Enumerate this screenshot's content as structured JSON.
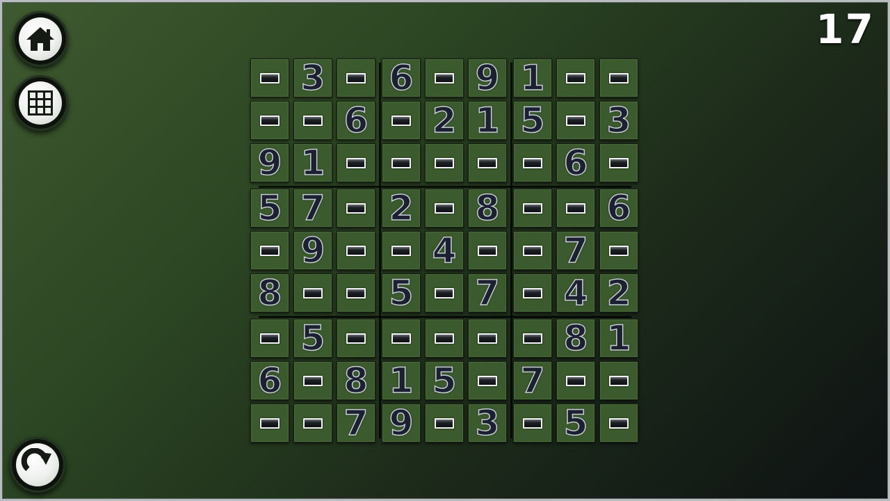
{
  "counter": "17",
  "icons": {
    "home": "home-icon",
    "grid": "grid-icon",
    "restart": "restart-icon"
  },
  "colors": {
    "cell_bg": "#3b5a2d",
    "digit_fill": "#1b2130",
    "digit_outline": "#c8cdd6"
  },
  "board": {
    "rows": [
      [
        "",
        "3",
        "",
        "6",
        "",
        "9",
        "1",
        "",
        ""
      ],
      [
        "",
        "",
        "6",
        "",
        "2",
        "1",
        "5",
        "",
        "3"
      ],
      [
        "9",
        "1",
        "",
        "",
        "",
        "",
        "",
        "6",
        ""
      ],
      [
        "5",
        "7",
        "",
        "2",
        "",
        "8",
        "",
        "",
        "6"
      ],
      [
        "",
        "9",
        "",
        "",
        "4",
        "",
        "",
        "7",
        ""
      ],
      [
        "8",
        "",
        "",
        "5",
        "",
        "7",
        "",
        "4",
        "2"
      ],
      [
        "",
        "5",
        "",
        "",
        "",
        "",
        "",
        "8",
        "1"
      ],
      [
        "6",
        "",
        "8",
        "1",
        "5",
        "",
        "7",
        "",
        ""
      ],
      [
        "",
        "",
        "7",
        "9",
        "",
        "3",
        "",
        "5",
        ""
      ]
    ]
  }
}
